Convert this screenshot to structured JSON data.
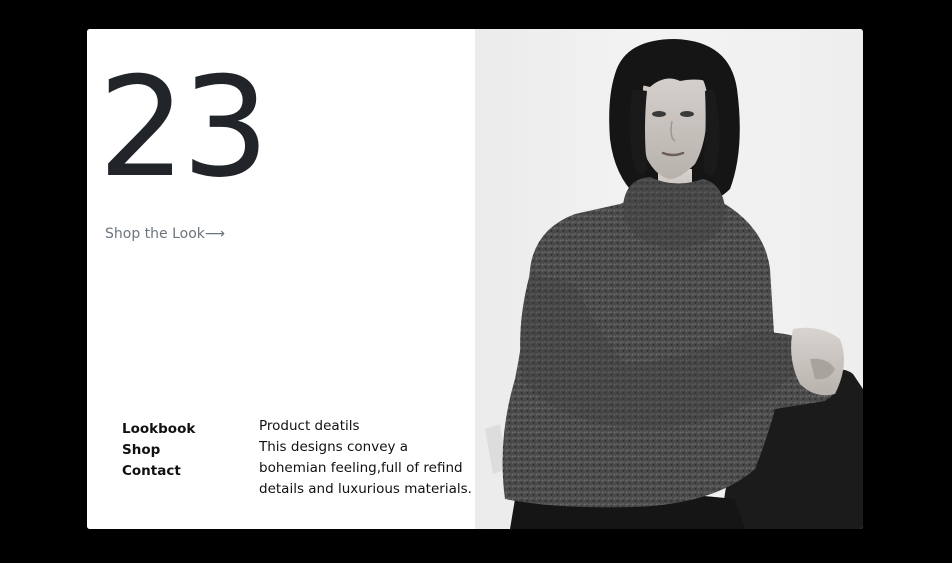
{
  "hero": {
    "number": "23",
    "shop_link": "Shop the Look⟶"
  },
  "nav": {
    "items": [
      "Lookbook",
      "Shop",
      "Contact"
    ]
  },
  "product": {
    "heading": "Product deatils",
    "description": "This designs convey a bohemian feeling,full of refind details and luxurious materials."
  },
  "photo": {
    "subject": "woman-in-knit-turtleneck",
    "style": "black-and-white"
  }
}
